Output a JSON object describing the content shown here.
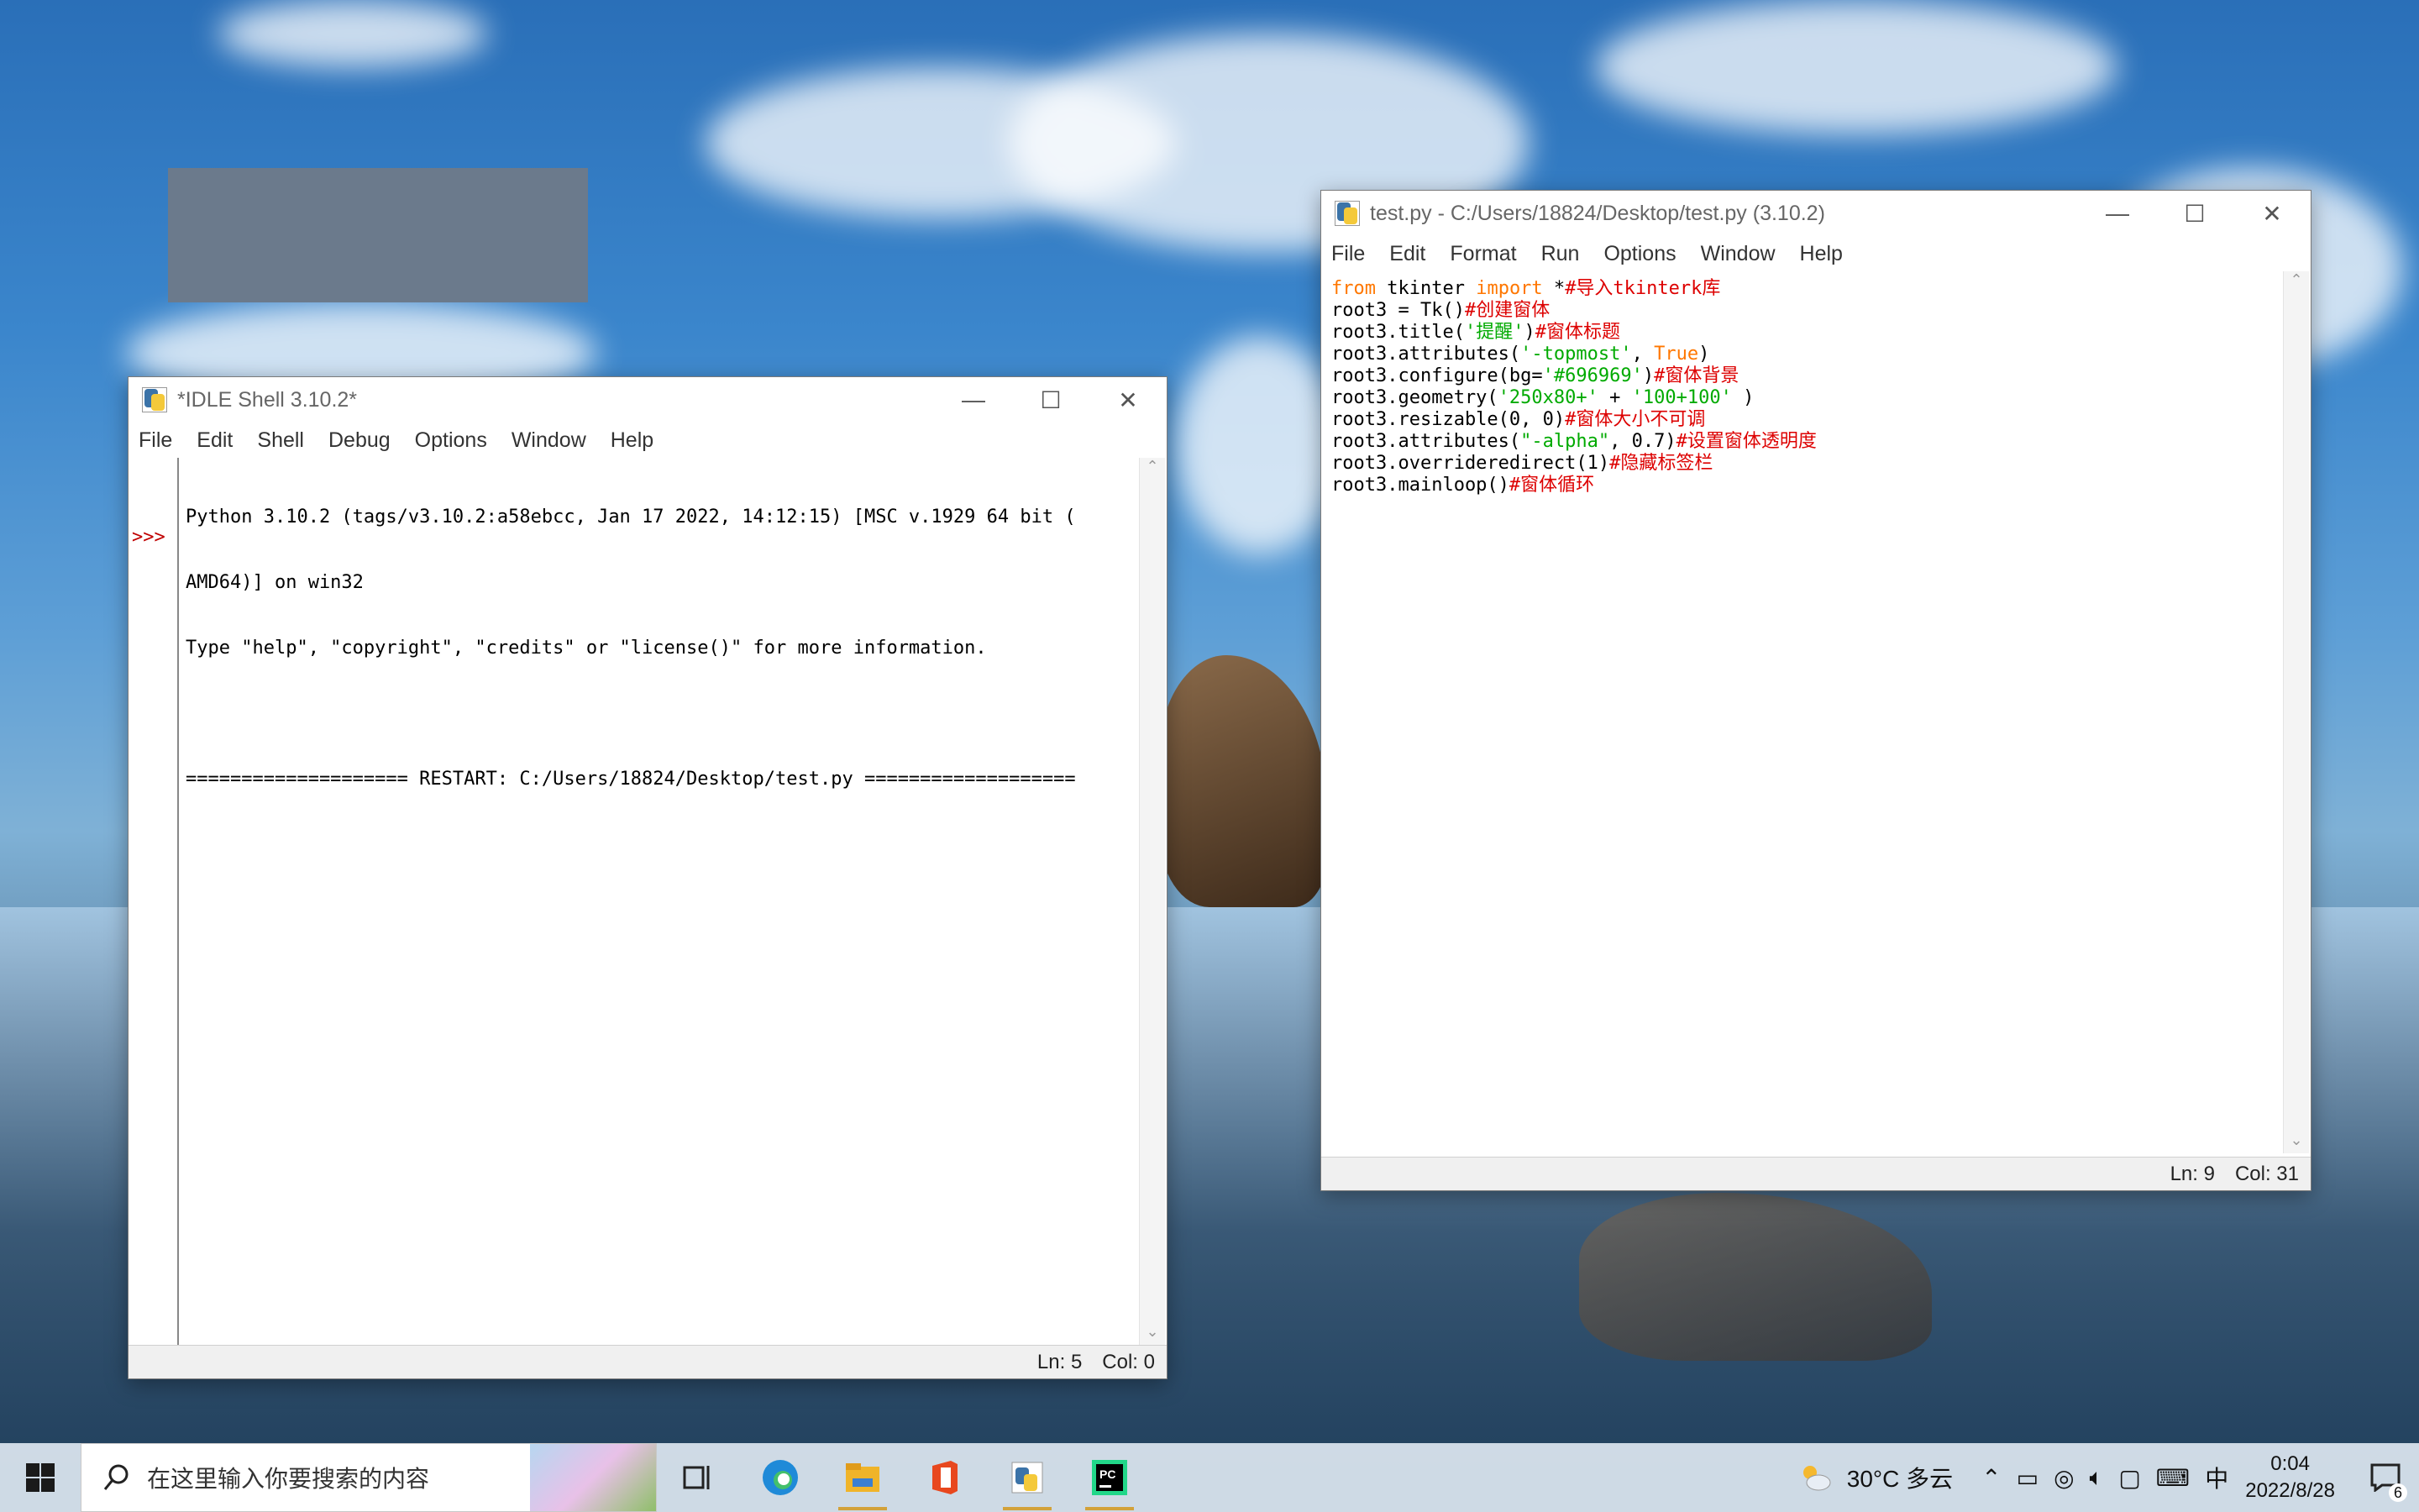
{
  "shell_window": {
    "title": "*IDLE Shell 3.10.2*",
    "menu": [
      "File",
      "Edit",
      "Shell",
      "Debug",
      "Options",
      "Window",
      "Help"
    ],
    "prompt": ">>>",
    "lines": [
      "Python 3.10.2 (tags/v3.10.2:a58ebcc, Jan 17 2022, 14:12:15) [MSC v.1929 64 bit (",
      "AMD64)] on win32",
      "Type \"help\", \"copyright\", \"credits\" or \"license()\" for more information.",
      "",
      "==================== RESTART: C:/Users/18824/Desktop/test.py ==================="
    ],
    "status_ln": "Ln: 5",
    "status_col": "Col: 0"
  },
  "editor_window": {
    "title": "test.py - C:/Users/18824/Desktop/test.py (3.10.2)",
    "menu": [
      "File",
      "Edit",
      "Format",
      "Run",
      "Options",
      "Window",
      "Help"
    ],
    "code": [
      [
        [
          "kw",
          "from"
        ],
        [
          "tx",
          " tkinter "
        ],
        [
          "kw",
          "import"
        ],
        [
          "tx",
          " *"
        ],
        [
          "cm",
          "#导入tkinterk库"
        ]
      ],
      [
        [
          "tx",
          "root3 = Tk()"
        ],
        [
          "cm",
          "#创建窗体"
        ]
      ],
      [
        [
          "tx",
          "root3.title("
        ],
        [
          "st",
          "'提醒'"
        ],
        [
          "tx",
          ")"
        ],
        [
          "cm",
          "#窗体标题"
        ]
      ],
      [
        [
          "tx",
          "root3.attributes("
        ],
        [
          "st",
          "'-topmost'"
        ],
        [
          "tx",
          ", "
        ],
        [
          "kw",
          "True"
        ],
        [
          "tx",
          ")"
        ]
      ],
      [
        [
          "tx",
          "root3.configure(bg="
        ],
        [
          "st",
          "'#696969'"
        ],
        [
          "tx",
          ")"
        ],
        [
          "cm",
          "#窗体背景"
        ]
      ],
      [
        [
          "tx",
          "root3.geometry("
        ],
        [
          "st",
          "'250x80+'"
        ],
        [
          "tx",
          " + "
        ],
        [
          "st",
          "'100+100'"
        ],
        [
          "tx",
          " )"
        ]
      ],
      [
        [
          "tx",
          "root3.resizable(0, 0)"
        ],
        [
          "cm",
          "#窗体大小不可调"
        ]
      ],
      [
        [
          "tx",
          "root3.attributes("
        ],
        [
          "st",
          "\"-alpha\""
        ],
        [
          "tx",
          ", 0.7)"
        ],
        [
          "cm",
          "#设置窗体透明度"
        ]
      ],
      [
        [
          "tx",
          "root3.overrideredirect(1)"
        ],
        [
          "cm",
          "#隐藏标签栏"
        ]
      ],
      [
        [
          "tx",
          "root3.mainloop()"
        ],
        [
          "cm",
          "#窗体循环"
        ]
      ]
    ],
    "status_ln": "Ln: 9",
    "status_col": "Col: 31"
  },
  "taskbar": {
    "search_placeholder": "在这里输入你要搜索的内容",
    "weather": "30°C 多云",
    "ime": "中",
    "time": "0:04",
    "date": "2022/8/28",
    "notifications": "6"
  },
  "colors": {
    "keyword": "#ff7700",
    "comment": "#dd0000",
    "string": "#00aa00",
    "prompt": "#c00000"
  }
}
